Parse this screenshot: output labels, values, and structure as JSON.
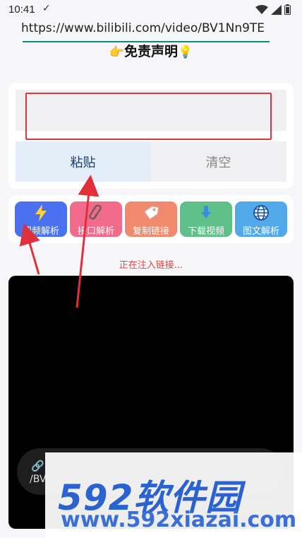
{
  "status_bar": {
    "time": "10:41",
    "check": "✓"
  },
  "title": {
    "left_emoji": "👉",
    "text": "免责声明",
    "right_emoji": "💡"
  },
  "url_input": {
    "value": "https://www.bilibili.com/video/BV1Nn9TE"
  },
  "buttons": {
    "paste": "粘贴",
    "clear": "清空"
  },
  "tools": [
    {
      "label": "视频解析",
      "color": "#4a72f0",
      "icon": "lightning-icon"
    },
    {
      "label": "接口解析",
      "color": "#f16a8a",
      "icon": "paperclip-icon"
    },
    {
      "label": "复制链接",
      "color": "#f18a6c",
      "icon": "tag-icon"
    },
    {
      "label": "下载视频",
      "color": "#5fc08a",
      "icon": "download-icon"
    },
    {
      "label": "图文解析",
      "color": "#52a9ea",
      "icon": "globe-icon"
    }
  ],
  "status_message": "正在注入链接...",
  "player": {
    "mini_text": "/BV"
  },
  "watermark": {
    "top": "592软件园",
    "bottom": "www.592xiazai.com"
  },
  "colors": {
    "accent_red": "#d9363e",
    "teal": "#0f8a7a"
  }
}
